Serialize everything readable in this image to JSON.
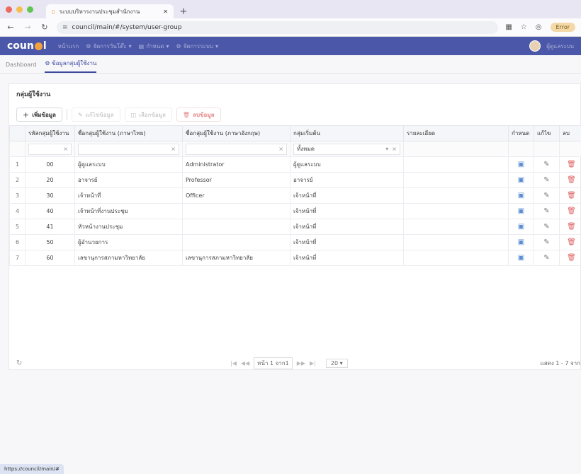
{
  "browser": {
    "tab_title": "ระบบบริหารงานประชุมสำนักงาน",
    "url": "council/main/#/system/user-group",
    "error_label": "Error"
  },
  "app": {
    "logo_left": "coun",
    "logo_right": "l",
    "nav": [
      {
        "label": "หน้าแรก",
        "icon": "home-icon"
      },
      {
        "label": "จัดการวันโต๊ะ",
        "icon": "gear-icon"
      },
      {
        "label": "กำหนด",
        "icon": "calendar-icon"
      },
      {
        "label": "จัดการระบบ",
        "icon": "settings-icon"
      }
    ],
    "user_name": "ผู้ดูแลระบบ"
  },
  "breadcrumb": {
    "home": "Dashboard",
    "current": "ข้อมูลกลุ่มผู้ใช้งาน"
  },
  "panel": {
    "title": "กลุ่มผู้ใช้งาน",
    "toolbar": {
      "add": "เพิ่มข้อมูล",
      "edit": "แก้ไขข้อมูล",
      "view": "เลือกข้อมูล",
      "delete": "ลบข้อมูล"
    }
  },
  "table": {
    "headers": [
      "รหัสกลุ่มผู้ใช้งาน",
      "ชื่อกลุ่มผู้ใช้งาน (ภาษาไทย)",
      "ชื่อกลุ่มผู้ใช้งาน (ภาษาอังกฤษ)",
      "กลุ่มเริ่มต้น",
      "รายละเอียด",
      "กำหนด",
      "แก้ไข",
      "ลบ"
    ],
    "filter_select": "ทั้งหมด",
    "rows": [
      {
        "no": "1",
        "code": "00",
        "name_th": "ผู้ดูแลระบบ",
        "name_en": "Administrator",
        "default_group": "ผู้ดูแลระบบ",
        "detail": ""
      },
      {
        "no": "2",
        "code": "20",
        "name_th": "อาจารย์",
        "name_en": "Professor",
        "default_group": "อาจารย์",
        "detail": ""
      },
      {
        "no": "3",
        "code": "30",
        "name_th": "เจ้าหน้าที่",
        "name_en": "Officer",
        "default_group": "เจ้าหน้าที่",
        "detail": ""
      },
      {
        "no": "4",
        "code": "40",
        "name_th": "เจ้าหน้าที่งานประชุม",
        "name_en": "",
        "default_group": "เจ้าหน้าที่",
        "detail": ""
      },
      {
        "no": "5",
        "code": "41",
        "name_th": "หัวหน้างานประชุม",
        "name_en": "",
        "default_group": "เจ้าหน้าที่",
        "detail": ""
      },
      {
        "no": "6",
        "code": "50",
        "name_th": "ผู้อำนวยการ",
        "name_en": "",
        "default_group": "เจ้าหน้าที่",
        "detail": ""
      },
      {
        "no": "7",
        "code": "60",
        "name_th": "เลขานุการสภามหาวิทยาลัย",
        "name_en": "เลขานุการสภามหาวิทยาลัย",
        "default_group": "เจ้าหน้าที่",
        "detail": ""
      }
    ]
  },
  "pager": {
    "page_label": "หน้า",
    "page": "1",
    "of_label": "จาก",
    "total_pages": "1",
    "page_size": "20",
    "info": "แสดง 1 - 7 จาก"
  },
  "statusbar": {
    "url": "https://council/main/#"
  }
}
